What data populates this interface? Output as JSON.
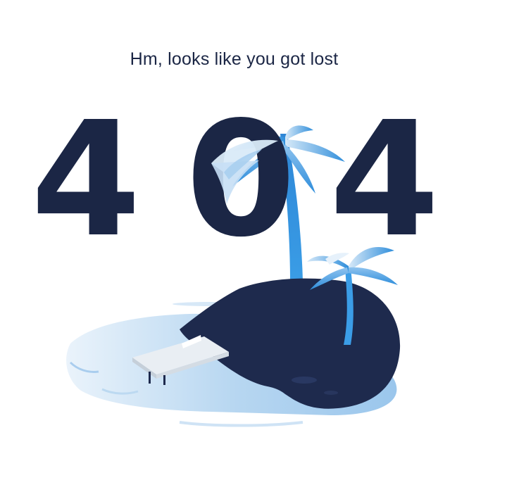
{
  "page": {
    "subtitle": "Hm, looks like you got lost",
    "error_code": {
      "first": "4",
      "second": "0",
      "third": "4"
    }
  },
  "illustration": {
    "subject": "island-with-palm-trees",
    "colors": {
      "digits": "#1b2645",
      "island": "#1e2a4d",
      "water_light": "#d4e6f6",
      "water_mid": "#a9cdee",
      "palm_bright": "#2e8ddb",
      "palm_light": "#8ec3ef",
      "dock": "#e9eef3"
    }
  }
}
